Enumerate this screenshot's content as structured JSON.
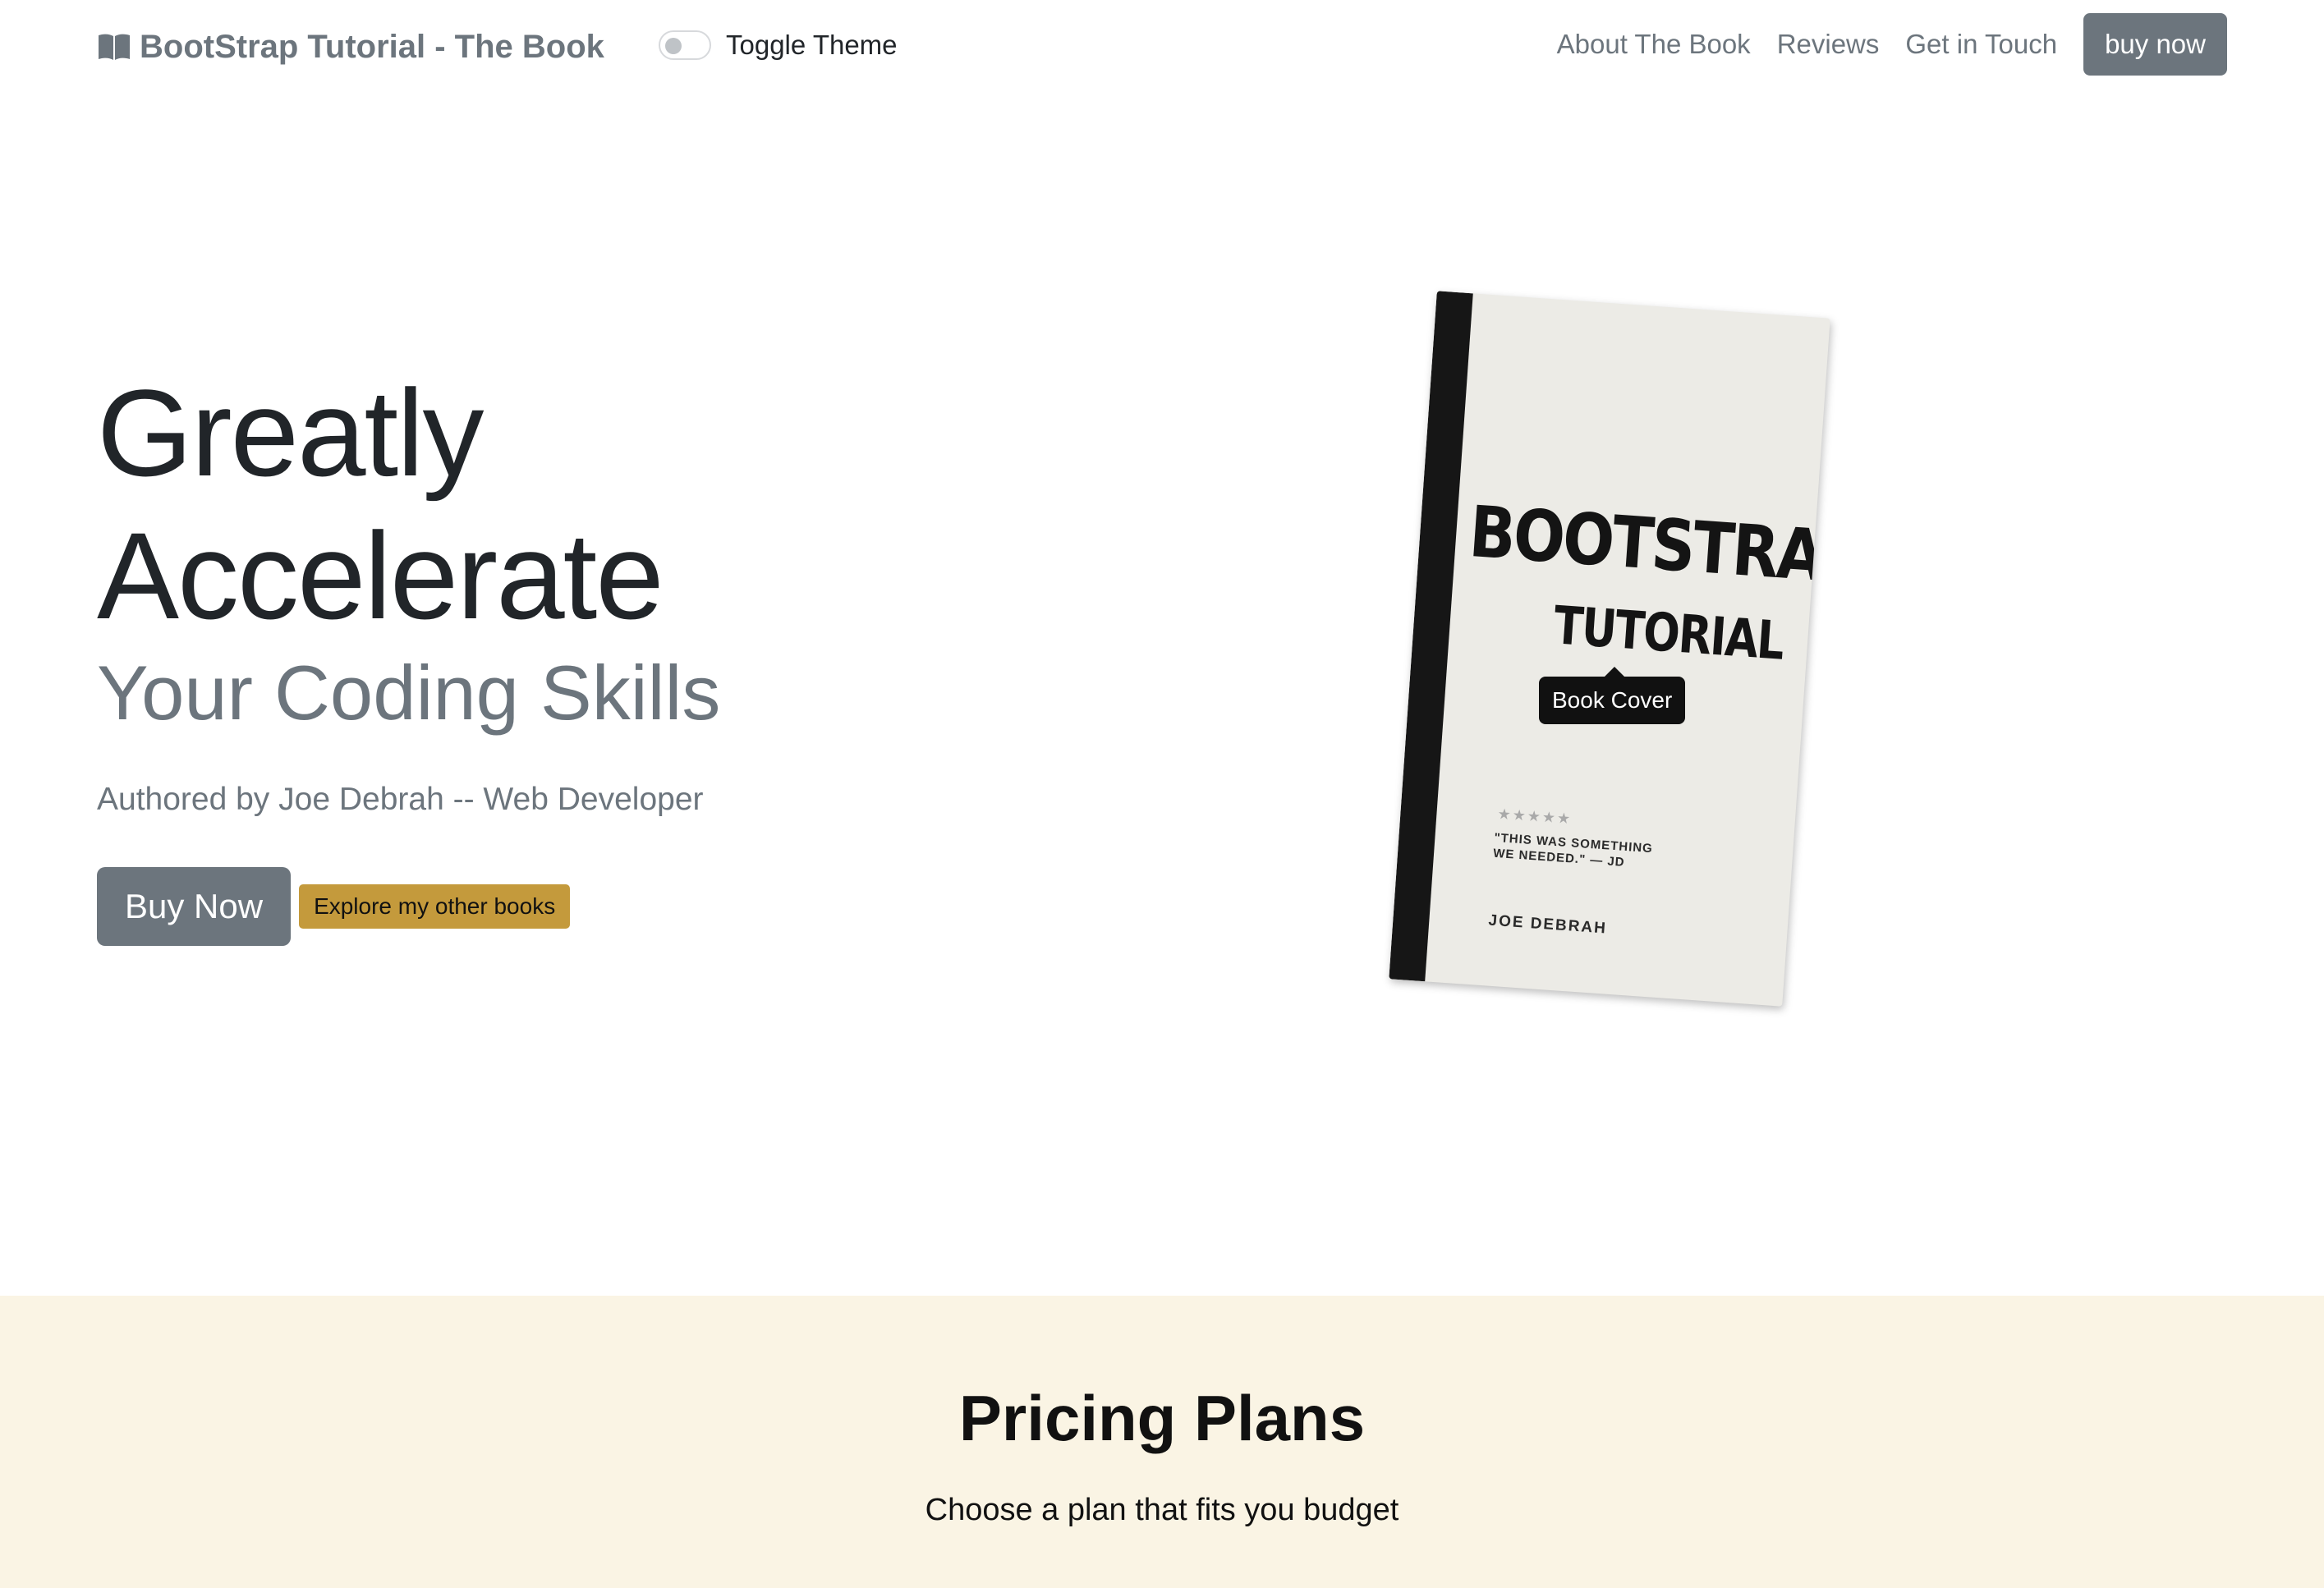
{
  "navbar": {
    "brand_icon": "open-book-icon",
    "brand": "BootStrap Tutorial - The Book",
    "toggle_label": "Toggle Theme",
    "links": [
      "About The Book",
      "Reviews",
      "Get in Touch"
    ],
    "buy_label": "buy now"
  },
  "hero": {
    "line1": "Greatly",
    "line2": "Accelerate",
    "line3": "Your Coding Skills",
    "author": "Authored by Joe Debrah -- Web Developer",
    "buy_button": "Buy Now",
    "explore_button": "Explore my other books"
  },
  "book": {
    "title": "BOOTSTRAP",
    "subtitle": "TUTORIAL",
    "stars": "★★★★★",
    "quote": "\"THIS WAS SOMETHING WE NEEDED.\" — JD",
    "author": "JOE DEBRAH",
    "tooltip": "Book Cover"
  },
  "pricing": {
    "title": "Pricing Plans",
    "subtitle": "Choose a plan that fits you budget"
  },
  "colors": {
    "secondary": "#6c757d",
    "accent_gold": "#c49a3c",
    "pricing_bg": "#faf4e4"
  }
}
